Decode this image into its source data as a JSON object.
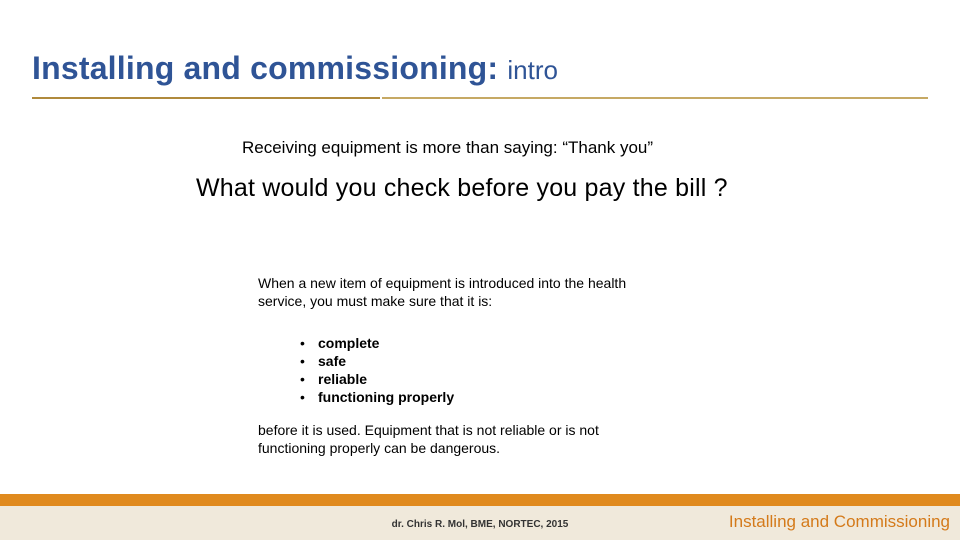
{
  "header": {
    "title_main": "Installing and commissioning: ",
    "title_sub": "intro"
  },
  "content": {
    "lead": "Receiving equipment is more than saying: “Thank you”",
    "question": "What would you check before you pay the bill ?",
    "body_intro": "When a new item of equipment is introduced into the health service, you must make sure that it is:",
    "bullets": [
      "complete",
      "safe",
      "reliable",
      "functioning properly"
    ],
    "body_outro": "before it is used. Equipment that is not reliable or is not functioning properly can be dangerous."
  },
  "footer": {
    "credit": "dr. Chris R. Mol, BME, NORTEC, 2015",
    "title": "Installing and Commissioning"
  }
}
